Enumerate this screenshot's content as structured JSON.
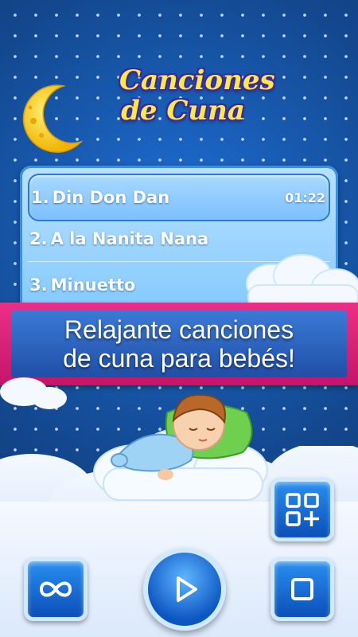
{
  "app": {
    "logo_line1": "Canciones",
    "logo_line2": "de Cuna"
  },
  "playlist": {
    "tracks": [
      {
        "number": "1.",
        "title": "Din Don Dan",
        "time": "01:22"
      },
      {
        "number": "2.",
        "title": "A la Nanita Nana",
        "time": ""
      },
      {
        "number": "3.",
        "title": "Minuetto",
        "time": ""
      }
    ]
  },
  "banner": {
    "line1": "Relajante canciones",
    "line2": "de cuna para bebés!"
  },
  "controls": {
    "repeat_icon": "infinity-icon",
    "play_icon": "play-icon",
    "stop_icon": "stop-icon",
    "more_apps_icon": "apps-plus-icon"
  },
  "colors": {
    "background": "#13488f",
    "banner": "#e0287c",
    "logo": "#ffe84d",
    "button": "#1a6fd8"
  }
}
